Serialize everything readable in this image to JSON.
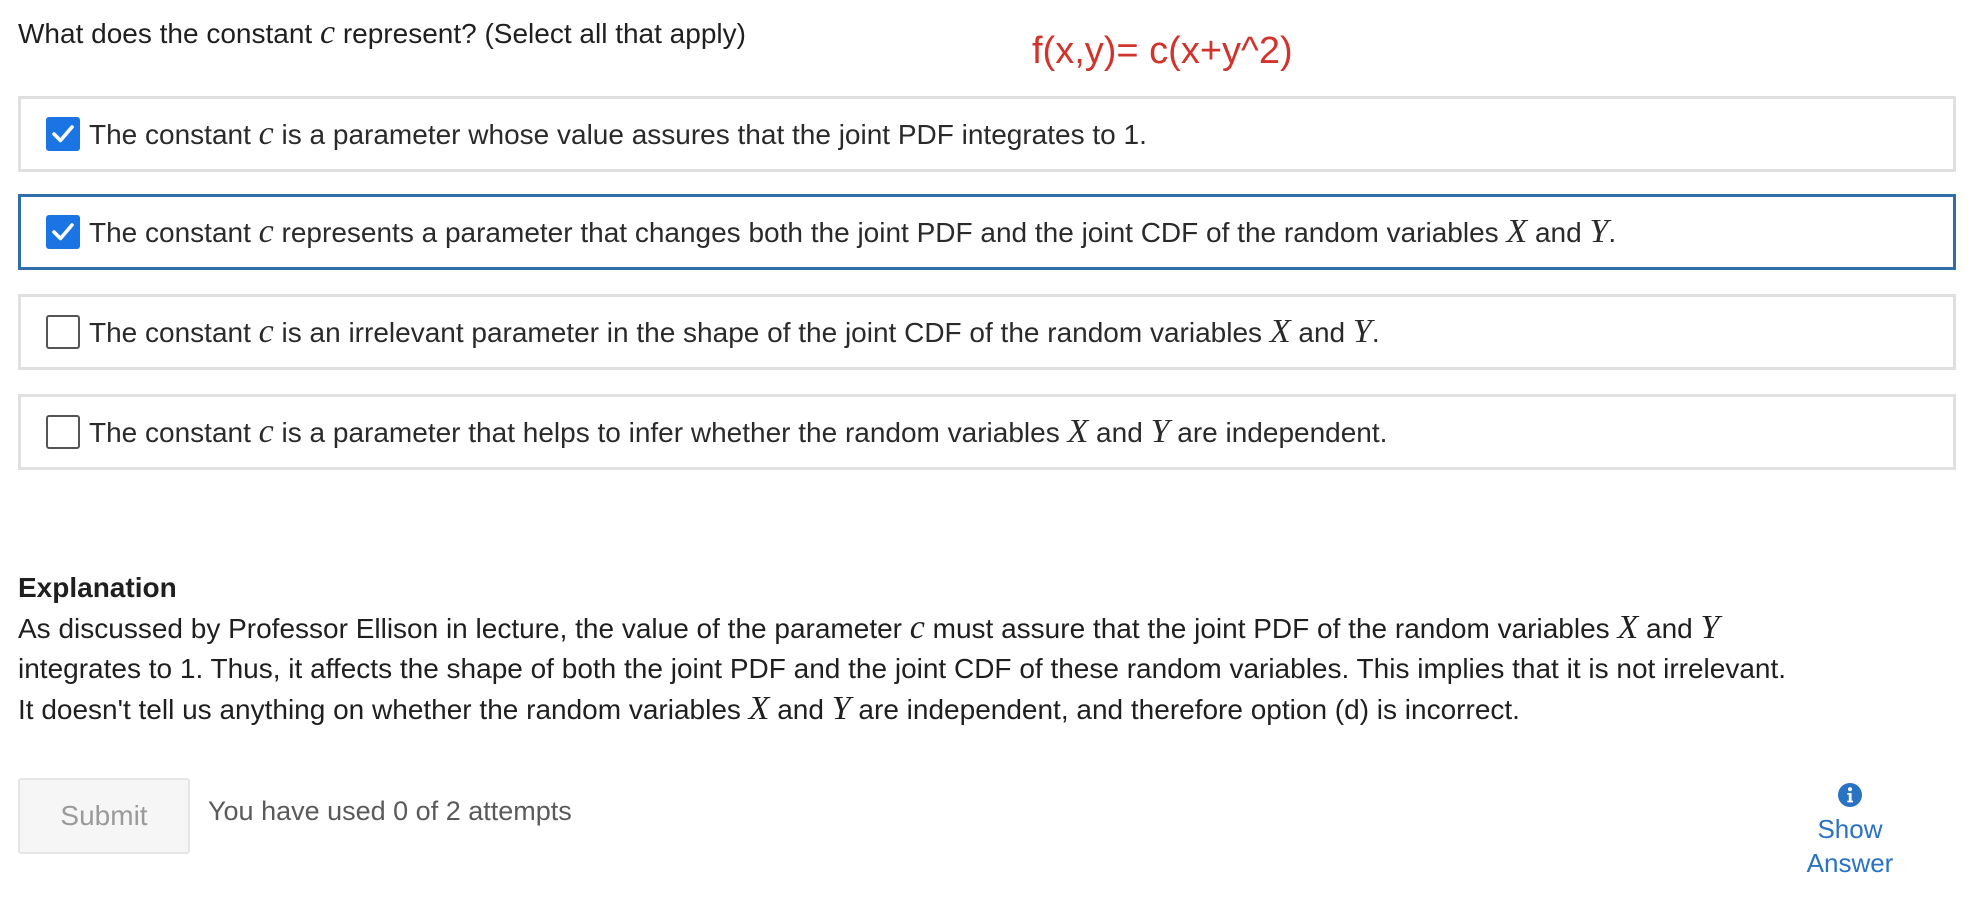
{
  "question": {
    "before": "What does the constant ",
    "var": "c",
    "after": " represent? (Select all that apply)"
  },
  "annotation": "f(x,y)= c(x+y^2)",
  "choices": [
    {
      "checked": true,
      "parts": [
        "The constant ",
        "c",
        " is a parameter whose value assures that the joint PDF integrates to 1."
      ]
    },
    {
      "checked": true,
      "parts": [
        "The constant ",
        "c",
        " represents a parameter that changes both the joint PDF and the joint CDF of the random variables ",
        "X",
        " and ",
        "Y",
        "."
      ]
    },
    {
      "checked": false,
      "parts": [
        "The constant ",
        "c",
        " is an irrelevant parameter in the shape of the joint CDF of the random variables ",
        "X",
        " and ",
        "Y",
        "."
      ]
    },
    {
      "checked": false,
      "parts": [
        "The constant ",
        "c",
        " is a parameter that helps to infer whether the random variables ",
        "X",
        " and ",
        "Y",
        " are independent."
      ]
    }
  ],
  "explanation": {
    "title": "Explanation",
    "line1": [
      "As discussed by Professor Ellison in lecture, the value of the parameter ",
      "c",
      " must assure that the joint PDF of the random variables ",
      "X",
      " and ",
      "Y"
    ],
    "line2": "integrates to 1. Thus, it affects the shape of both the joint PDF and the joint CDF of these random variables. This implies that it is not irrelevant.",
    "line3": [
      "It doesn't tell us anything on whether the random variables ",
      "X",
      " and ",
      "Y",
      " are independent, and therefore option (d) is incorrect."
    ]
  },
  "submit_label": "Submit",
  "attempts_text": "You have used 0 of 2 attempts",
  "show_answer": {
    "line1": "Show",
    "line2": "Answer",
    "icon": "info-icon"
  },
  "colors": {
    "accent": "#1a74e3",
    "selected_border": "#2f6ea8",
    "annotation": "#d0342c",
    "link": "#2a72c4"
  }
}
